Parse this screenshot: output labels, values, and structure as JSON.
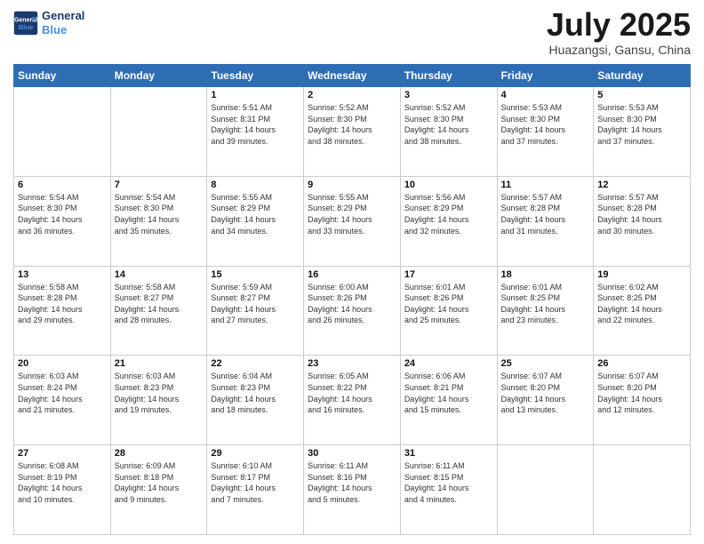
{
  "logo": {
    "line1": "General",
    "line2": "Blue"
  },
  "title": "July 2025",
  "location": "Huazangsi, Gansu, China",
  "weekdays": [
    "Sunday",
    "Monday",
    "Tuesday",
    "Wednesday",
    "Thursday",
    "Friday",
    "Saturday"
  ],
  "weeks": [
    [
      {
        "day": "",
        "text": ""
      },
      {
        "day": "",
        "text": ""
      },
      {
        "day": "1",
        "text": "Sunrise: 5:51 AM\nSunset: 8:31 PM\nDaylight: 14 hours\nand 39 minutes."
      },
      {
        "day": "2",
        "text": "Sunrise: 5:52 AM\nSunset: 8:30 PM\nDaylight: 14 hours\nand 38 minutes."
      },
      {
        "day": "3",
        "text": "Sunrise: 5:52 AM\nSunset: 8:30 PM\nDaylight: 14 hours\nand 38 minutes."
      },
      {
        "day": "4",
        "text": "Sunrise: 5:53 AM\nSunset: 8:30 PM\nDaylight: 14 hours\nand 37 minutes."
      },
      {
        "day": "5",
        "text": "Sunrise: 5:53 AM\nSunset: 8:30 PM\nDaylight: 14 hours\nand 37 minutes."
      }
    ],
    [
      {
        "day": "6",
        "text": "Sunrise: 5:54 AM\nSunset: 8:30 PM\nDaylight: 14 hours\nand 36 minutes."
      },
      {
        "day": "7",
        "text": "Sunrise: 5:54 AM\nSunset: 8:30 PM\nDaylight: 14 hours\nand 35 minutes."
      },
      {
        "day": "8",
        "text": "Sunrise: 5:55 AM\nSunset: 8:29 PM\nDaylight: 14 hours\nand 34 minutes."
      },
      {
        "day": "9",
        "text": "Sunrise: 5:55 AM\nSunset: 8:29 PM\nDaylight: 14 hours\nand 33 minutes."
      },
      {
        "day": "10",
        "text": "Sunrise: 5:56 AM\nSunset: 8:29 PM\nDaylight: 14 hours\nand 32 minutes."
      },
      {
        "day": "11",
        "text": "Sunrise: 5:57 AM\nSunset: 8:28 PM\nDaylight: 14 hours\nand 31 minutes."
      },
      {
        "day": "12",
        "text": "Sunrise: 5:57 AM\nSunset: 8:28 PM\nDaylight: 14 hours\nand 30 minutes."
      }
    ],
    [
      {
        "day": "13",
        "text": "Sunrise: 5:58 AM\nSunset: 8:28 PM\nDaylight: 14 hours\nand 29 minutes."
      },
      {
        "day": "14",
        "text": "Sunrise: 5:58 AM\nSunset: 8:27 PM\nDaylight: 14 hours\nand 28 minutes."
      },
      {
        "day": "15",
        "text": "Sunrise: 5:59 AM\nSunset: 8:27 PM\nDaylight: 14 hours\nand 27 minutes."
      },
      {
        "day": "16",
        "text": "Sunrise: 6:00 AM\nSunset: 8:26 PM\nDaylight: 14 hours\nand 26 minutes."
      },
      {
        "day": "17",
        "text": "Sunrise: 6:01 AM\nSunset: 8:26 PM\nDaylight: 14 hours\nand 25 minutes."
      },
      {
        "day": "18",
        "text": "Sunrise: 6:01 AM\nSunset: 8:25 PM\nDaylight: 14 hours\nand 23 minutes."
      },
      {
        "day": "19",
        "text": "Sunrise: 6:02 AM\nSunset: 8:25 PM\nDaylight: 14 hours\nand 22 minutes."
      }
    ],
    [
      {
        "day": "20",
        "text": "Sunrise: 6:03 AM\nSunset: 8:24 PM\nDaylight: 14 hours\nand 21 minutes."
      },
      {
        "day": "21",
        "text": "Sunrise: 6:03 AM\nSunset: 8:23 PM\nDaylight: 14 hours\nand 19 minutes."
      },
      {
        "day": "22",
        "text": "Sunrise: 6:04 AM\nSunset: 8:23 PM\nDaylight: 14 hours\nand 18 minutes."
      },
      {
        "day": "23",
        "text": "Sunrise: 6:05 AM\nSunset: 8:22 PM\nDaylight: 14 hours\nand 16 minutes."
      },
      {
        "day": "24",
        "text": "Sunrise: 6:06 AM\nSunset: 8:21 PM\nDaylight: 14 hours\nand 15 minutes."
      },
      {
        "day": "25",
        "text": "Sunrise: 6:07 AM\nSunset: 8:20 PM\nDaylight: 14 hours\nand 13 minutes."
      },
      {
        "day": "26",
        "text": "Sunrise: 6:07 AM\nSunset: 8:20 PM\nDaylight: 14 hours\nand 12 minutes."
      }
    ],
    [
      {
        "day": "27",
        "text": "Sunrise: 6:08 AM\nSunset: 8:19 PM\nDaylight: 14 hours\nand 10 minutes."
      },
      {
        "day": "28",
        "text": "Sunrise: 6:09 AM\nSunset: 8:18 PM\nDaylight: 14 hours\nand 9 minutes."
      },
      {
        "day": "29",
        "text": "Sunrise: 6:10 AM\nSunset: 8:17 PM\nDaylight: 14 hours\nand 7 minutes."
      },
      {
        "day": "30",
        "text": "Sunrise: 6:11 AM\nSunset: 8:16 PM\nDaylight: 14 hours\nand 5 minutes."
      },
      {
        "day": "31",
        "text": "Sunrise: 6:11 AM\nSunset: 8:15 PM\nDaylight: 14 hours\nand 4 minutes."
      },
      {
        "day": "",
        "text": ""
      },
      {
        "day": "",
        "text": ""
      }
    ]
  ]
}
